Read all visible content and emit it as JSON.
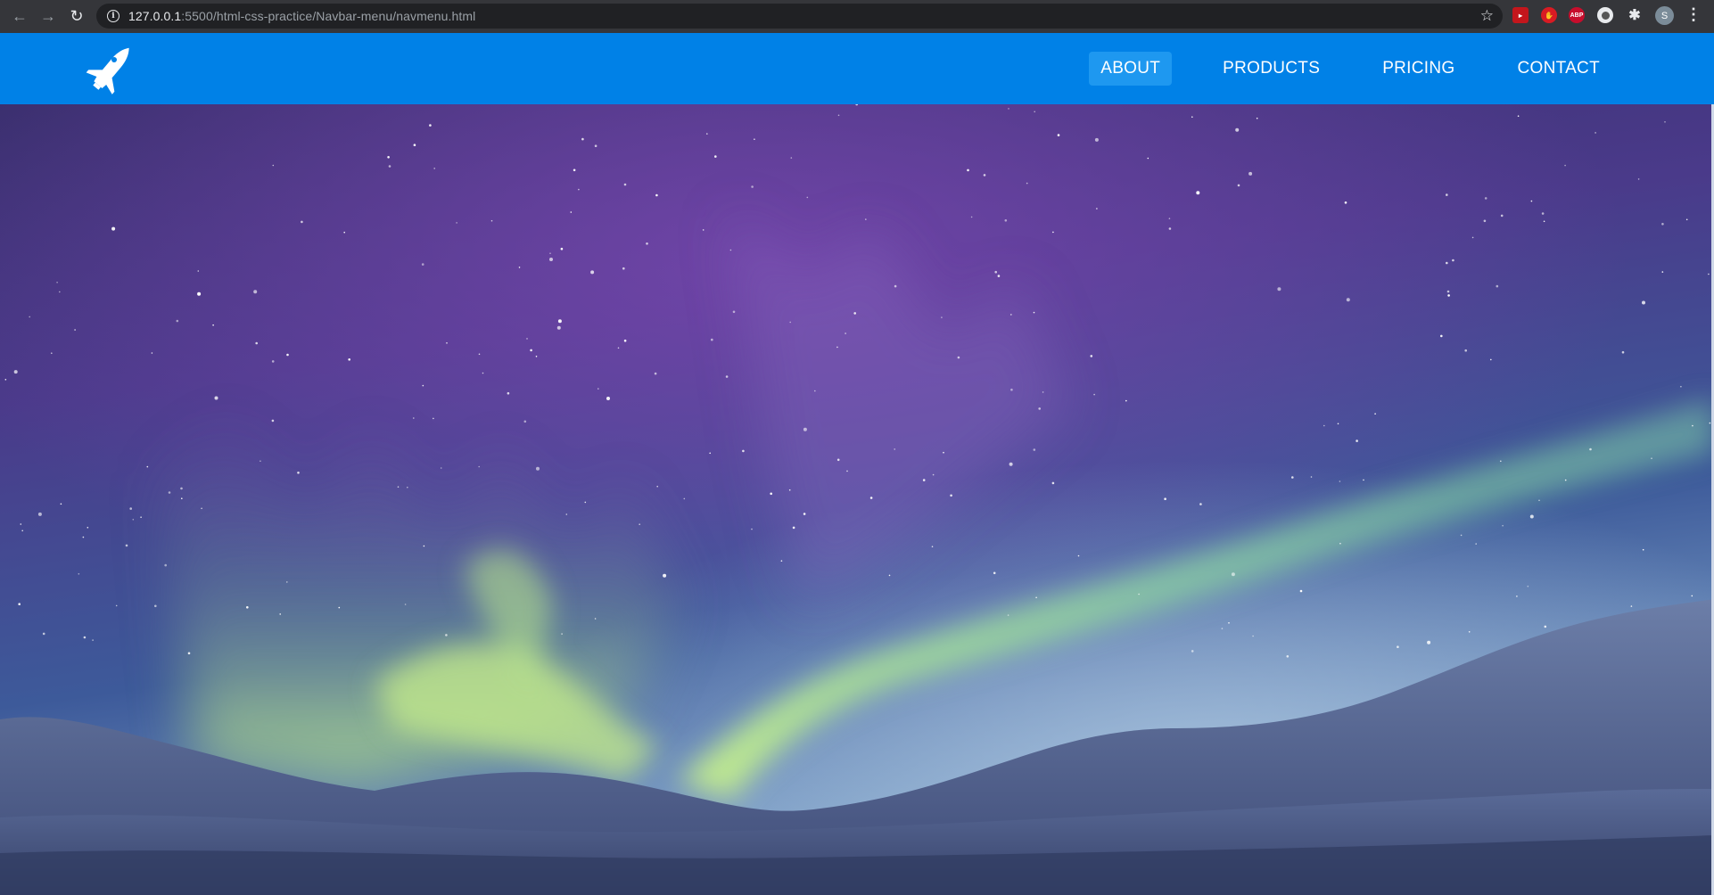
{
  "browser": {
    "url_host": "127.0.0.1",
    "url_rest": ":5500/html-css-practice/Navbar-menu/navmenu.html",
    "profile_initial": "S",
    "ext_abp_label": "ABP"
  },
  "navbar": {
    "logo_icon": "space-shuttle-icon",
    "items": [
      {
        "label": "ABOUT",
        "active": true
      },
      {
        "label": "PRODUCTS",
        "active": false
      },
      {
        "label": "PRICING",
        "active": false
      },
      {
        "label": "CONTACT",
        "active": false
      }
    ],
    "colors": {
      "bar": "#0081e7",
      "active_bg": "#1e98f0"
    }
  },
  "hero": {
    "image": "aurora-over-snowy-mountains"
  }
}
